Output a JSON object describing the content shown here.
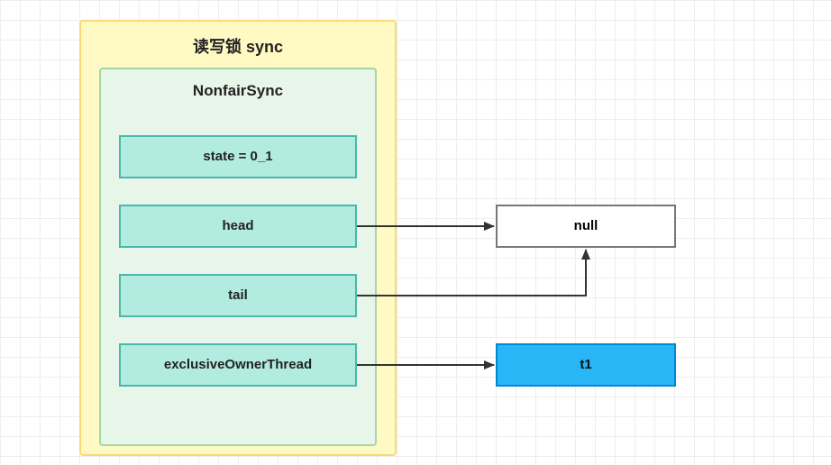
{
  "outer": {
    "title": "读写锁 sync"
  },
  "inner": {
    "title": "NonfairSync",
    "fields": {
      "state": "state = 0_1",
      "head": "head",
      "tail": "tail",
      "exclusiveOwnerThread": "exclusiveOwnerThread"
    }
  },
  "nodes": {
    "null": "null",
    "t1": "t1"
  },
  "colors": {
    "outer_bg": "#fff9c4",
    "inner_bg": "#e8f5e9",
    "field_bg": "#b2ebe0",
    "t1_bg": "#29b6f6"
  }
}
